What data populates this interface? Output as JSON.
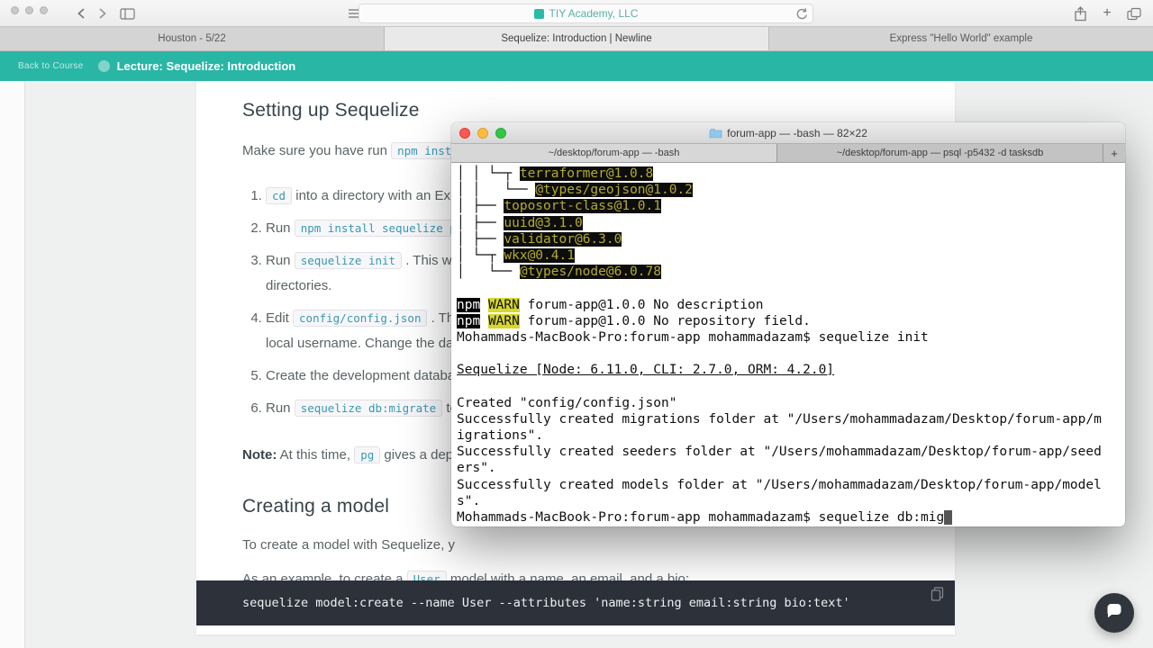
{
  "browser": {
    "address_title": "TIY Academy, LLC",
    "tabs": [
      {
        "label": "Houston - 5/22"
      },
      {
        "label": "Sequelize: Introduction | Newline"
      },
      {
        "label": "Express \"Hello World\" example"
      }
    ]
  },
  "lesson_header": {
    "back": "Back to Course",
    "title": "Lecture: Sequelize: Introduction"
  },
  "lesson": {
    "heading_setup": "Setting up Sequelize",
    "intro_pre": "Make sure you have run ",
    "intro_code": "npm inst",
    "steps": [
      {
        "pre": "",
        "code": "cd",
        "post": " into a directory with an Exp",
        "line2": ""
      },
      {
        "pre": "Run ",
        "code": "npm install sequelize p",
        "post": "",
        "line2": ""
      },
      {
        "pre": "Run ",
        "code": "sequelize init",
        "post": " . This will",
        "line2": "directories."
      },
      {
        "pre": "Edit ",
        "code": "config/config.json",
        "post": " . The",
        "line2": "local username. Change the data"
      },
      {
        "pre": "Create the development databas",
        "code": "",
        "post": "",
        "line2": ""
      },
      {
        "pre": "Run ",
        "code": "sequelize db:migrate",
        "post": " to",
        "line2": ""
      }
    ],
    "note_label": "Note:",
    "note_pre": " At this time, ",
    "note_code": "pg",
    "note_post": " gives a depr",
    "heading_model": "Creating a model",
    "para_model": "To create a model with Sequelize, y",
    "example_pre": "As an example, to create a ",
    "example_code": "User",
    "example_post": " model with a name, an email, and a bio:",
    "command": "sequelize model:create --name User --attributes 'name:string email:string bio:text'"
  },
  "terminal": {
    "title": "forum-app — -bash — 82×22",
    "tabs": [
      {
        "label": "~/desktop/forum-app — -bash"
      },
      {
        "label": "~/desktop/forum-app — psql -p5432 -d tasksdb"
      }
    ],
    "new_tab": "+",
    "lines": [
      [
        {
          "t": "│ │ └─┬ ",
          "s": "plain"
        },
        {
          "t": "terraformer@1.0.8",
          "s": "pkg"
        }
      ],
      [
        {
          "t": "│ │   └── ",
          "s": "plain"
        },
        {
          "t": "@types/geojson@1.0.2",
          "s": "pkg"
        }
      ],
      [
        {
          "t": "│ ├── ",
          "s": "plain"
        },
        {
          "t": "toposort-class@1.0.1",
          "s": "pkg"
        }
      ],
      [
        {
          "t": "│ ├── ",
          "s": "plain"
        },
        {
          "t": "uuid@3.1.0",
          "s": "pkg"
        }
      ],
      [
        {
          "t": "│ ├── ",
          "s": "plain"
        },
        {
          "t": "validator@6.3.0",
          "s": "pkg"
        }
      ],
      [
        {
          "t": "│ └─┬ ",
          "s": "plain"
        },
        {
          "t": "wkx@0.4.1",
          "s": "pkg"
        }
      ],
      [
        {
          "t": "│   └── ",
          "s": "plain"
        },
        {
          "t": "@types/node@6.0.78",
          "s": "pkg"
        }
      ],
      [],
      [
        {
          "t": "npm",
          "s": "npm"
        },
        {
          "t": " ",
          "s": "plain"
        },
        {
          "t": "WARN",
          "s": "warn"
        },
        {
          "t": " forum-app@1.0.0 No description",
          "s": "plain"
        }
      ],
      [
        {
          "t": "npm",
          "s": "npm"
        },
        {
          "t": " ",
          "s": "plain"
        },
        {
          "t": "WARN",
          "s": "warn"
        },
        {
          "t": " forum-app@1.0.0 No repository field.",
          "s": "plain"
        }
      ],
      [
        {
          "t": "Mohammads-MacBook-Pro:forum-app mohammadazam$ sequelize init",
          "s": "plain"
        }
      ],
      [],
      [
        {
          "t": "Sequelize [Node: 6.11.0, CLI: 2.7.0, ORM: 4.2.0]",
          "s": "underline"
        }
      ],
      [],
      [
        {
          "t": "Created \"config/config.json\"",
          "s": "plain"
        }
      ],
      [
        {
          "t": "Successfully created migrations folder at \"/Users/mohammadazam/Desktop/forum-app/m",
          "s": "plain"
        }
      ],
      [
        {
          "t": "igrations\".",
          "s": "plain"
        }
      ],
      [
        {
          "t": "Successfully created seeders folder at \"/Users/mohammadazam/Desktop/forum-app/seed",
          "s": "plain"
        }
      ],
      [
        {
          "t": "ers\".",
          "s": "plain"
        }
      ],
      [
        {
          "t": "Successfully created models folder at \"/Users/mohammadazam/Desktop/forum-app/model",
          "s": "plain"
        }
      ],
      [
        {
          "t": "s\".",
          "s": "plain"
        }
      ],
      [
        {
          "t": "Mohammads-MacBook-Pro:forum-app mohammadazam$ sequelize db:mig",
          "s": "plain"
        },
        {
          "t": " ",
          "s": "cursor"
        }
      ]
    ]
  },
  "colors": {
    "accent_teal": "#29b6a4",
    "terminal_highlight_text": "#b3ab2f",
    "warn_yellow": "#d7d72e",
    "code_block_bg": "#2c313a"
  }
}
